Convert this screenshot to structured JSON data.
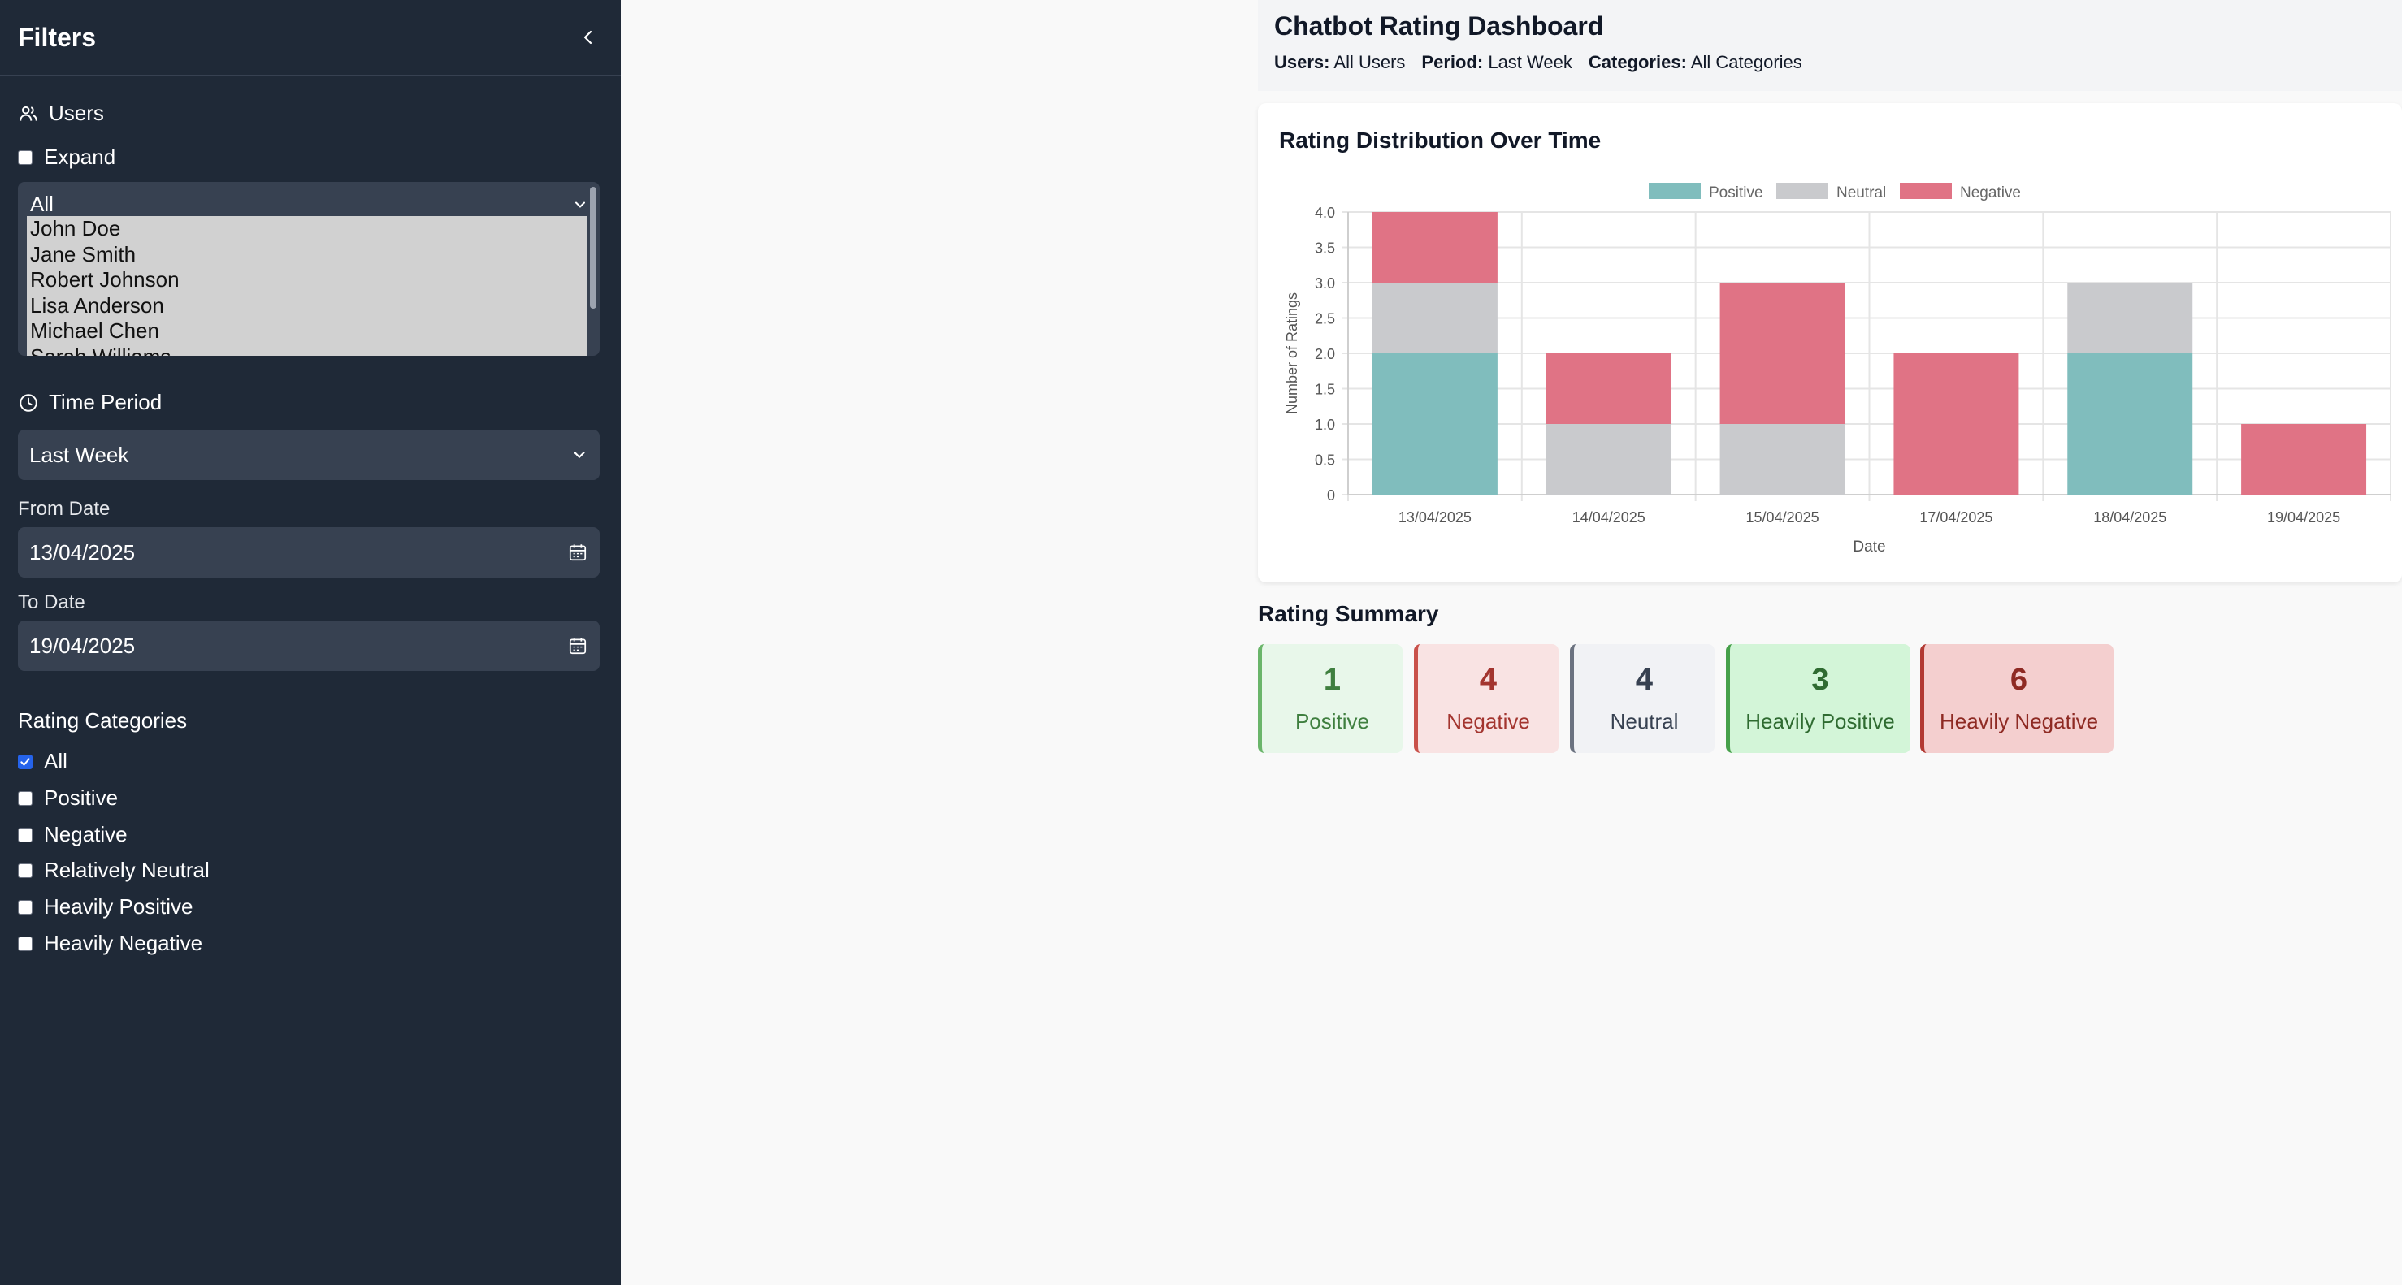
{
  "sidebar": {
    "title": "Filters",
    "users": {
      "heading": "Users",
      "expand_label": "Expand",
      "expand_checked": false,
      "selected": "All",
      "options": [
        "John Doe",
        "Jane Smith",
        "Robert Johnson",
        "Lisa Anderson",
        "Michael Chen",
        "Sarah Williams"
      ]
    },
    "time_period": {
      "heading": "Time Period",
      "value": "Last Week",
      "from_label": "From Date",
      "from_value": "13/04/2025",
      "to_label": "To Date",
      "to_value": "19/04/2025"
    },
    "categories": {
      "heading": "Rating Categories",
      "items": [
        {
          "label": "All",
          "checked": true
        },
        {
          "label": "Positive",
          "checked": false
        },
        {
          "label": "Negative",
          "checked": false
        },
        {
          "label": "Relatively Neutral",
          "checked": false
        },
        {
          "label": "Heavily Positive",
          "checked": false
        },
        {
          "label": "Heavily Negative",
          "checked": false
        }
      ]
    }
  },
  "header": {
    "title": "Chatbot Rating Dashboard",
    "filters": [
      {
        "key": "Users:",
        "value": "All Users"
      },
      {
        "key": "Period:",
        "value": "Last Week"
      },
      {
        "key": "Categories:",
        "value": "All Categories"
      }
    ]
  },
  "chart_card": {
    "title": "Rating Distribution Over Time"
  },
  "chart_data": {
    "type": "bar",
    "stacked": true,
    "categories": [
      "13/04/2025",
      "14/04/2025",
      "15/04/2025",
      "17/04/2025",
      "18/04/2025",
      "19/04/2025"
    ],
    "series": [
      {
        "name": "Positive",
        "color": "#80bdbd",
        "values": [
          2,
          0,
          0,
          0,
          2,
          0
        ]
      },
      {
        "name": "Neutral",
        "color": "#c9cacd",
        "values": [
          1,
          1,
          1,
          0,
          1,
          0
        ]
      },
      {
        "name": "Negative",
        "color": "#e07385",
        "values": [
          1,
          1,
          2,
          2,
          0,
          1
        ]
      }
    ],
    "xlabel": "Date",
    "ylabel": "Number of Ratings",
    "ylim": [
      0,
      4
    ],
    "yticks": [
      "0",
      "0.5",
      "1.0",
      "1.5",
      "2.0",
      "2.5",
      "3.0",
      "3.5",
      "4.0"
    ],
    "grid": true,
    "legend_position": "top-center"
  },
  "summary": {
    "title": "Rating Summary",
    "cards": [
      {
        "count": "1",
        "label": "Positive",
        "bg": "#e8f7ea",
        "fg": "#3f7f3f",
        "border": "#6ab56a"
      },
      {
        "count": "4",
        "label": "Negative",
        "bg": "#f9e3e3",
        "fg": "#a3352f",
        "border": "#c9514a"
      },
      {
        "count": "4",
        "label": "Neutral",
        "bg": "#f1f2f5",
        "fg": "#374151",
        "border": "#6b7280"
      },
      {
        "count": "3",
        "label": "Heavily Positive",
        "bg": "#d3f5d8",
        "fg": "#2f6b31",
        "border": "#46a04a"
      },
      {
        "count": "6",
        "label": "Heavily Negative",
        "bg": "#f4cfcf",
        "fg": "#8e2a23",
        "border": "#b23a33"
      }
    ]
  }
}
